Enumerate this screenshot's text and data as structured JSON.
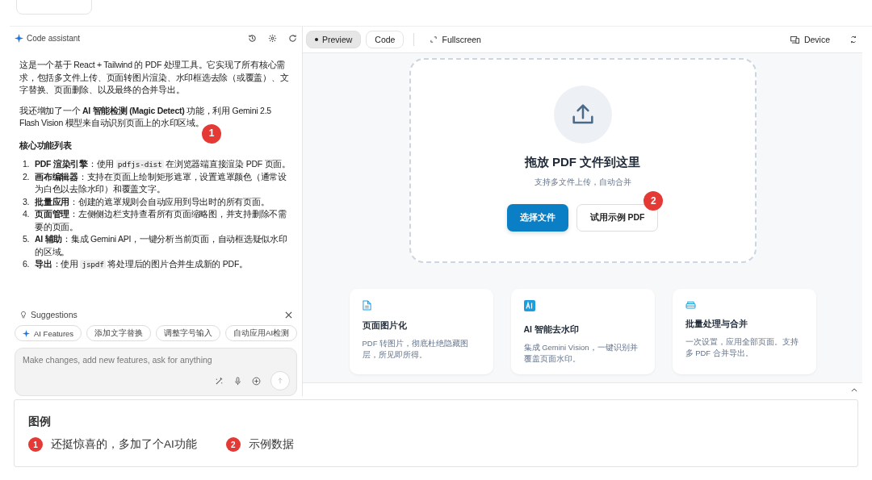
{
  "assistant": {
    "title": "Code assistant",
    "paragraphs": [
      {
        "parts": [
          {
            "kind": "text",
            "text": "这是一个基于 React + Tailwind 的 PDF 处理工具。它实现了所有核心需求，包括多文件上传、页面转图片渲染、水印框选去除（或覆盖）、文字替换、页面删除、以及最终的合并导出。"
          }
        ]
      },
      {
        "annotation": "1",
        "parts": [
          {
            "kind": "text",
            "text": "我还增加了一个 "
          },
          {
            "kind": "bold",
            "text": "AI 智能检测 (Magic Detect)"
          },
          {
            "kind": "text",
            "text": " 功能，利用 Gemini 2.5 Flash Vision 模型来自动识别页面上的水印区域。"
          }
        ]
      }
    ],
    "list_heading": "核心功能列表",
    "list": [
      {
        "number": "1.",
        "parts": [
          {
            "kind": "bold",
            "text": "PDF 渲染引擎"
          },
          {
            "kind": "text",
            "text": "：使用 "
          },
          {
            "kind": "code",
            "text": "pdfjs-dist"
          },
          {
            "kind": "text",
            "text": " 在浏览器端直接渲染 PDF 页面。"
          }
        ]
      },
      {
        "number": "2.",
        "parts": [
          {
            "kind": "bold",
            "text": "画布编辑器"
          },
          {
            "kind": "text",
            "text": "：支持在页面上绘制矩形遮罩，设置遮罩颜色（通常设为白色以去除水印）和覆盖文字。"
          }
        ]
      },
      {
        "number": "3.",
        "parts": [
          {
            "kind": "bold",
            "text": "批量应用"
          },
          {
            "kind": "text",
            "text": "：创建的遮罩规则会自动应用到导出时的所有页面。"
          }
        ]
      },
      {
        "number": "4.",
        "parts": [
          {
            "kind": "bold",
            "text": "页面管理"
          },
          {
            "kind": "text",
            "text": "：左侧侧边栏支持查看所有页面缩略图，并支持删除不需要的页面。"
          }
        ]
      },
      {
        "number": "5.",
        "parts": [
          {
            "kind": "bold",
            "text": "AI 辅助"
          },
          {
            "kind": "text",
            "text": "：集成 Gemini API，一键分析当前页面，自动框选疑似水印的区域。"
          }
        ]
      },
      {
        "number": "6.",
        "parts": [
          {
            "kind": "bold",
            "text": "导出"
          },
          {
            "kind": "text",
            "text": "：使用 "
          },
          {
            "kind": "code",
            "text": "jspdf"
          },
          {
            "kind": "text",
            "text": " 将处理后的图片合并生成新的 PDF。"
          }
        ]
      }
    ],
    "suggestions_title": "Suggestions",
    "chips": [
      {
        "label": "AI Features",
        "kind": "ai"
      },
      {
        "label": "添加文字替换",
        "kind": "plain"
      },
      {
        "label": "调整字号输入",
        "kind": "plain"
      },
      {
        "label": "自动应用AI检测",
        "kind": "plain"
      }
    ],
    "input": {
      "placeholder": "Make changes, add new features, ask for anything"
    }
  },
  "preview": {
    "tabs": [
      {
        "label": "Preview",
        "selected": true
      },
      {
        "label": "Code",
        "selected": false
      }
    ],
    "fullscreen": "Fullscreen",
    "device": "Device",
    "dropzone": {
      "title": "拖放 PDF 文件到这里",
      "subtitle": "支持多文件上传，自动合并",
      "primary": "选择文件",
      "secondary": "试用示例 PDF",
      "secondary_annotation": "2"
    },
    "features": [
      {
        "kind": "doc",
        "title": "页面图片化",
        "text": "PDF 转图片，彻底杜绝隐藏图层，所见即所得。"
      },
      {
        "kind": "ai",
        "title": "AI 智能去水印",
        "text": "集成 Gemini Vision，一键识别并覆盖页面水印。"
      },
      {
        "kind": "stack",
        "title": "批量处理与合并",
        "text": "一次设置，应用全部页面。支持多 PDF 合并导出。"
      }
    ]
  },
  "legend": {
    "title": "图例",
    "items": [
      {
        "number": "1",
        "text": "还挺惊喜的，多加了个AI功能"
      },
      {
        "number": "2",
        "text": "示例数据"
      }
    ]
  }
}
